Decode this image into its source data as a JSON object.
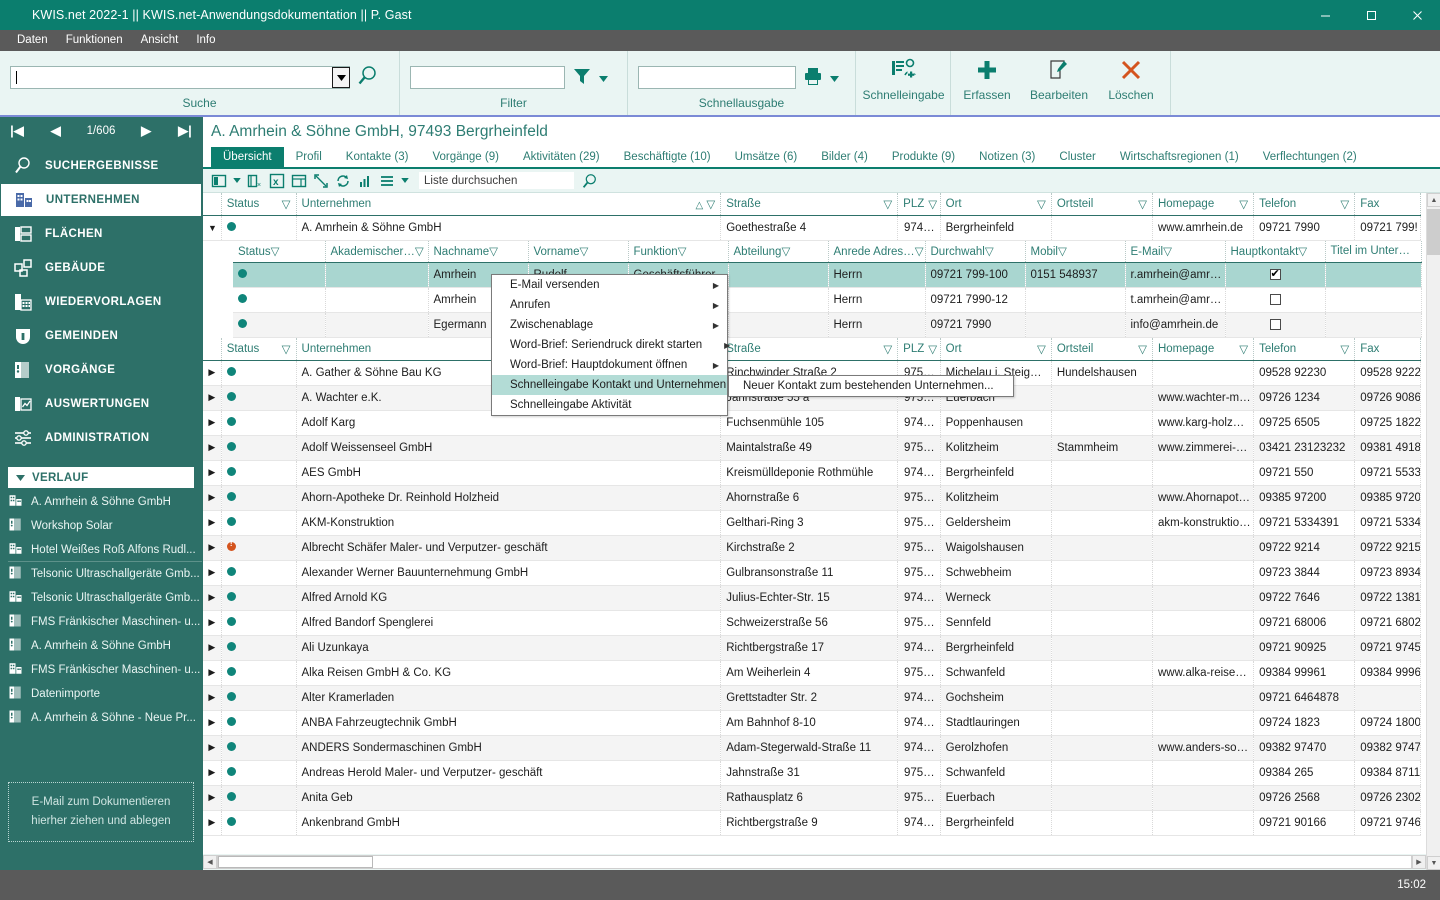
{
  "window": {
    "title": "KWIS.net 2022-1 || KWIS.net-Anwendungsdokumentation || P. Gast",
    "minimize": "–",
    "maximize": "□",
    "close": "✕"
  },
  "menubar": {
    "items": [
      "Daten",
      "Funktionen",
      "Ansicht",
      "Info"
    ]
  },
  "ribbon": {
    "groups": [
      {
        "label": "Suche",
        "value": "",
        "placeholder": ""
      },
      {
        "label": "Filter",
        "value": "",
        "placeholder": ""
      },
      {
        "label": "Schnellausgabe",
        "value": "",
        "placeholder": ""
      }
    ],
    "commands": [
      {
        "label": "Schnelleingabe",
        "icon": "quick-entry-icon"
      },
      {
        "label": "Erfassen",
        "icon": "plus-icon"
      },
      {
        "label": "Bearbeiten",
        "icon": "edit-icon"
      },
      {
        "label": "Löschen",
        "icon": "delete-x-icon"
      }
    ]
  },
  "sidebar": {
    "pager": {
      "first": "|◀",
      "prev": "◀",
      "counter": "1/606",
      "next": "▶",
      "last": "▶|"
    },
    "nav": [
      {
        "label": "SUCHERGEBNISSE",
        "icon": "search-icon",
        "active": false
      },
      {
        "label": "UNTERNEHMEN",
        "icon": "company-icon",
        "active": true
      },
      {
        "label": "FLÄCHEN",
        "icon": "areas-icon",
        "active": false
      },
      {
        "label": "GEBÄUDE",
        "icon": "building-icon",
        "active": false
      },
      {
        "label": "WIEDERVORLAGEN",
        "icon": "calendar-icon",
        "active": false
      },
      {
        "label": "GEMEINDEN",
        "icon": "shield-icon",
        "active": false
      },
      {
        "label": "VORGÄNGE",
        "icon": "folder-icon",
        "active": false
      },
      {
        "label": "AUSWERTUNGEN",
        "icon": "chart-icon",
        "active": false
      },
      {
        "label": "ADMINISTRATION",
        "icon": "sliders-icon",
        "active": false
      }
    ],
    "history_header": "VERLAUF",
    "history": [
      {
        "label": "A. Amrhein & Söhne GmbH",
        "icon": "company-icon"
      },
      {
        "label": "Workshop Solar",
        "icon": "folder-icon"
      },
      {
        "label": "Hotel Weißes Roß Alfons Rudl...",
        "icon": "company-icon"
      },
      {
        "label": "Telsonic Ultraschallgeräte Gmb...",
        "icon": "folder-icon"
      },
      {
        "label": "Telsonic Ultraschallgeräte Gmb...",
        "icon": "company-icon"
      },
      {
        "label": "FMS Fränkischer Maschinen- u...",
        "icon": "folder-icon"
      },
      {
        "label": "A. Amrhein & Söhne GmbH",
        "icon": "folder-icon"
      },
      {
        "label": "FMS Fränkischer Maschinen- u...",
        "icon": "company-icon"
      },
      {
        "label": "Datenimporte",
        "icon": "folder-icon"
      },
      {
        "label": "A. Amrhein & Söhne - Neue Pr...",
        "icon": "folder-icon"
      }
    ],
    "dropzone_line1": "E-Mail  zum Dokumentieren",
    "dropzone_line2": "hierher ziehen und ablegen"
  },
  "record": {
    "title": "A. Amrhein & Söhne GmbH, 97493 Bergrheinfeld",
    "tabs": [
      {
        "label": "Übersicht",
        "active": true
      },
      {
        "label": "Profil",
        "active": false
      },
      {
        "label": "Kontakte (3)",
        "active": false
      },
      {
        "label": "Vorgänge (9)",
        "active": false
      },
      {
        "label": "Aktivitäten (29)",
        "active": false
      },
      {
        "label": "Beschäftigte (10)",
        "active": false
      },
      {
        "label": "Umsätze (6)",
        "active": false
      },
      {
        "label": "Bilder (4)",
        "active": false
      },
      {
        "label": "Produkte (9)",
        "active": false
      },
      {
        "label": "Notizen (3)",
        "active": false
      },
      {
        "label": "Cluster",
        "active": false
      },
      {
        "label": "Wirtschaftsregionen (1)",
        "active": false
      },
      {
        "label": "Verflechtungen (2)",
        "active": false
      }
    ]
  },
  "gridbar": {
    "icons": [
      "columns-icon",
      "chevron-down-icon",
      "remove-column-icon",
      "excel-export-icon",
      "layout-icon",
      "expand-icon",
      "refresh-icon",
      "statistics-icon",
      "menu-icon",
      "chevron-down-icon"
    ],
    "search_value": "Liste durchsuchen",
    "search_icon": "search-icon"
  },
  "company_grid": {
    "columns": [
      "Status",
      "Unternehmen",
      "Straße",
      "PLZ",
      "Ort",
      "Ortsteil",
      "Homepage",
      "Telefon",
      "Fax"
    ],
    "sorted_column": "Unternehmen",
    "top_row": {
      "status": "ok",
      "unternehmen": "A. Amrhein & Söhne GmbH",
      "strasse": "Goethestraße 4",
      "plz": "974…",
      "ort": "Bergrheinfeld",
      "ortsteil": "",
      "homepage": "www.amrhein.de",
      "telefon": "09721 7990",
      "fax": "09721 799!"
    },
    "rows": [
      {
        "status": "ok",
        "unternehmen": "A. Gather & Söhne Bau KG",
        "strasse": "Rinchwinder Straße 2",
        "plz": "975…",
        "ort": "Michelau i. Steig…",
        "ortsteil": "Hundelshausen",
        "homepage": "",
        "telefon": "09528 92230",
        "fax": "09528 9222"
      },
      {
        "status": "ok",
        "unternehmen": "A. Wachter e.K.",
        "strasse": "Jahnstraße 55 a",
        "plz": "975…",
        "ort": "Euerbach",
        "ortsteil": "",
        "homepage": "www.wachter-m…",
        "telefon": "09726 1234",
        "fax": "09726 9086"
      },
      {
        "status": "ok",
        "unternehmen": "Adolf Karg",
        "strasse": "Fuchsenmühle 105",
        "plz": "974…",
        "ort": "Poppenhausen",
        "ortsteil": "",
        "homepage": "www.karg-holz…",
        "telefon": "09725 6505",
        "fax": "09725 1822"
      },
      {
        "status": "ok",
        "unternehmen": "Adolf Weissenseel GmbH",
        "strasse": "Maintalstraße 49",
        "plz": "975…",
        "ort": "Kolitzheim",
        "ortsteil": "Stammheim",
        "homepage": "www.zimmerei-…",
        "telefon": "03421 23123232",
        "fax": "09381 4918"
      },
      {
        "status": "ok",
        "unternehmen": "AES GmbH",
        "strasse": "Kreismülldeponie Rothmühle",
        "plz": "974…",
        "ort": "Bergrheinfeld",
        "ortsteil": "",
        "homepage": "",
        "telefon": "09721 550",
        "fax": "09721 5533"
      },
      {
        "status": "ok",
        "unternehmen": "Ahorn-Apotheke Dr. Reinhold Holzheid",
        "strasse": "Ahornstraße 6",
        "plz": "975…",
        "ort": "Kolitzheim",
        "ortsteil": "",
        "homepage": "www.Ahornapot…",
        "telefon": "09385 97200",
        "fax": "09385 9720"
      },
      {
        "status": "ok",
        "unternehmen": "AKM-Konstruktion",
        "strasse": "Gelthari-Ring 3",
        "plz": "975…",
        "ort": "Geldersheim",
        "ortsteil": "",
        "homepage": "akm-konstruktio…",
        "telefon": "09721 5334391",
        "fax": "09721 5334"
      },
      {
        "status": "warn",
        "unternehmen": "Albrecht Schäfer Maler- und Verputzer- geschäft",
        "strasse": "Kirchstraße 2",
        "plz": "975…",
        "ort": "Waigolshausen",
        "ortsteil": "",
        "homepage": "",
        "telefon": "09722 9214",
        "fax": "09722 9215"
      },
      {
        "status": "ok",
        "unternehmen": "Alexander Werner Bauunternehmung GmbH",
        "strasse": "Gulbransonstraße 11",
        "plz": "975…",
        "ort": "Schwebheim",
        "ortsteil": "",
        "homepage": "",
        "telefon": "09723 3844",
        "fax": "09723 8934"
      },
      {
        "status": "ok",
        "unternehmen": "Alfred Arnold KG",
        "strasse": "Julius-Echter-Str. 15",
        "plz": "974…",
        "ort": "Werneck",
        "ortsteil": "",
        "homepage": "",
        "telefon": "09722 7646",
        "fax": "09722 1381"
      },
      {
        "status": "ok",
        "unternehmen": "Alfred Bandorf Spenglerei",
        "strasse": "Schweizerstraße 56",
        "plz": "975…",
        "ort": "Sennfeld",
        "ortsteil": "",
        "homepage": "",
        "telefon": "09721 68006",
        "fax": "09721 6802"
      },
      {
        "status": "ok",
        "unternehmen": "Ali Uzunkaya",
        "strasse": "Richtbergstraße 17",
        "plz": "974…",
        "ort": "Bergrheinfeld",
        "ortsteil": "",
        "homepage": "",
        "telefon": "09721 90925",
        "fax": "09721 9745"
      },
      {
        "status": "ok",
        "unternehmen": "Alka Reisen GmbH & Co. KG",
        "strasse": "Am Weiherlein 4",
        "plz": "975…",
        "ort": "Schwanfeld",
        "ortsteil": "",
        "homepage": "www.alka-reise…",
        "telefon": "09384 99961",
        "fax": "09384 9996"
      },
      {
        "status": "ok",
        "unternehmen": "Alter Kramerladen",
        "strasse": "Grettstadter Str. 2",
        "plz": "974…",
        "ort": "Gochsheim",
        "ortsteil": "",
        "homepage": "",
        "telefon": "09721 6464878",
        "fax": ""
      },
      {
        "status": "ok",
        "unternehmen": "ANBA Fahrzeugtechnik GmbH",
        "strasse": "Am Bahnhof 8-10",
        "plz": "974…",
        "ort": "Stadtlauringen",
        "ortsteil": "",
        "homepage": "",
        "telefon": "09724 1823",
        "fax": "09724 1800"
      },
      {
        "status": "ok",
        "unternehmen": "ANDERS Sondermaschinen GmbH",
        "strasse": "Adam-Stegerwald-Straße 11",
        "plz": "974…",
        "ort": "Gerolzhofen",
        "ortsteil": "",
        "homepage": "www.anders-so…",
        "telefon": "09382 97470",
        "fax": "09382 9747"
      },
      {
        "status": "ok",
        "unternehmen": "Andreas Herold Maler- und Verputzer- geschäft",
        "strasse": "Jahnstraße 31",
        "plz": "975…",
        "ort": "Schwanfeld",
        "ortsteil": "",
        "homepage": "",
        "telefon": "09384 265",
        "fax": "09384 8711"
      },
      {
        "status": "ok",
        "unternehmen": "Anita Geb",
        "strasse": "Rathausplatz 6",
        "plz": "975…",
        "ort": "Euerbach",
        "ortsteil": "",
        "homepage": "",
        "telefon": "09726 2568",
        "fax": "09726 2302"
      },
      {
        "status": "ok",
        "unternehmen": "Ankenbrand GmbH",
        "strasse": "Richtbergstraße 9",
        "plz": "974…",
        "ort": "Bergrheinfeld",
        "ortsteil": "",
        "homepage": "",
        "telefon": "09721 90166",
        "fax": "09721 9746"
      }
    ]
  },
  "contact_grid": {
    "columns": [
      "Status",
      "Akademischer…",
      "Nachname",
      "Vorname",
      "Funktion",
      "Abteilung",
      "Anrede Adres…",
      "Durchwahl",
      "Mobil",
      "E-Mail",
      "Hauptkontakt",
      "Titel im Unter…"
    ],
    "rows": [
      {
        "status": "ok",
        "akad": "",
        "nachname": "Amrhein",
        "vorname": "Rudolf",
        "funktion": "Geschäftsführer…",
        "abteilung": "",
        "anrede": "Herrn",
        "durchwahl": "09721 799-100",
        "mobil": "0151 548937",
        "email": "r.amrhein@amr…",
        "hauptkontakt": true,
        "titel": "",
        "selected": true
      },
      {
        "status": "ok",
        "akad": "",
        "nachname": "Amrhein",
        "vorname": "",
        "funktion": "",
        "abteilung": "",
        "anrede": "Herrn",
        "durchwahl": "09721 7990-12",
        "mobil": "",
        "email": "t.amrhein@amr…",
        "hauptkontakt": false,
        "titel": "",
        "selected": false
      },
      {
        "status": "ok",
        "akad": "",
        "nachname": "Egermann",
        "vorname": "",
        "funktion": "",
        "abteilung": "",
        "anrede": "Herrn",
        "durchwahl": "09721 7990",
        "mobil": "",
        "email": "info@amrhein.de",
        "hauptkontakt": false,
        "titel": "",
        "selected": false
      }
    ]
  },
  "context_menu": {
    "items": [
      {
        "label": "E-Mail versenden",
        "has_submenu": true,
        "highlighted": false
      },
      {
        "label": "Anrufen",
        "has_submenu": true,
        "highlighted": false
      },
      {
        "label": "Zwischenablage",
        "has_submenu": true,
        "highlighted": false
      },
      {
        "label": "Word-Brief: Seriendruck direkt starten",
        "has_submenu": true,
        "highlighted": false
      },
      {
        "label": "Word-Brief: Hauptdokument öffnen",
        "has_submenu": true,
        "highlighted": false
      },
      {
        "label": "Schnelleingabe Kontakt und Unternehmen",
        "has_submenu": true,
        "highlighted": true
      },
      {
        "label": "Schnelleingabe Aktivität",
        "has_submenu": false,
        "highlighted": false
      }
    ],
    "submenu": {
      "items": [
        "Neuer Kontakt zum bestehenden Unternehmen..."
      ]
    }
  },
  "statusbar": {
    "time": "15:02"
  },
  "colors": {
    "brand_teal": "#0b7e6e",
    "sidebar_teal": "#2d7068",
    "accent_text": "#2e7d73",
    "status_ok": "#0f857a",
    "status_warn": "#d4541e",
    "selection": "#a9d6d0",
    "menubar_gray": "#5a5a5a",
    "ribbon_bg": "#eaf5f3",
    "ribbon_underline": "#7b8ad6"
  }
}
